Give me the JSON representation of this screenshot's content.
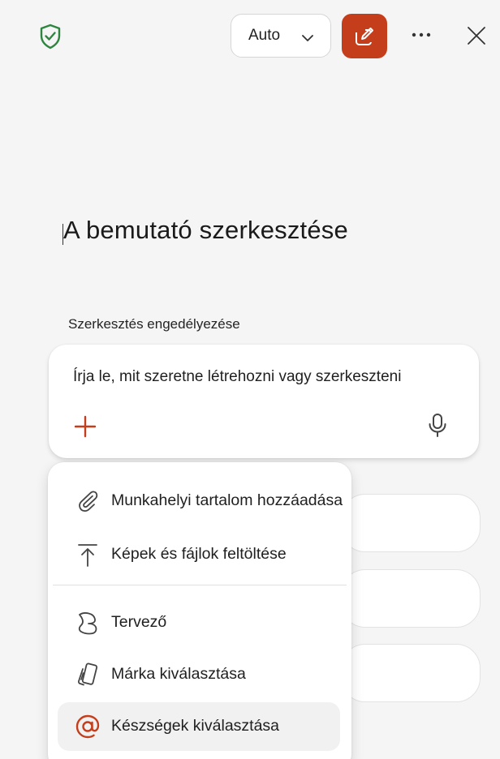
{
  "header": {
    "mode_select_value": "Auto"
  },
  "page_title": "A bemutató szerkesztése",
  "section_label": "Szerkesztés engedélyezése",
  "prompt": {
    "placeholder": "Írja le, mit szeretne létrehozni vagy szerkeszteni"
  },
  "menu": {
    "items": [
      {
        "label": "Munkahelyi tartalom hozzáadása",
        "icon": "paperclip-icon"
      },
      {
        "label": "Képek és fájlok feltöltése",
        "icon": "upload-icon"
      },
      {
        "label": "Tervező",
        "icon": "designer-icon"
      },
      {
        "label": "Márka kiválasztása",
        "icon": "brand-icon"
      },
      {
        "label": "Készségek kiválasztása",
        "icon": "at-sign-icon",
        "active": true
      }
    ]
  },
  "colors": {
    "accent": "#c43e1c",
    "shield": "#2e8540",
    "background": "#f5f5f5"
  }
}
